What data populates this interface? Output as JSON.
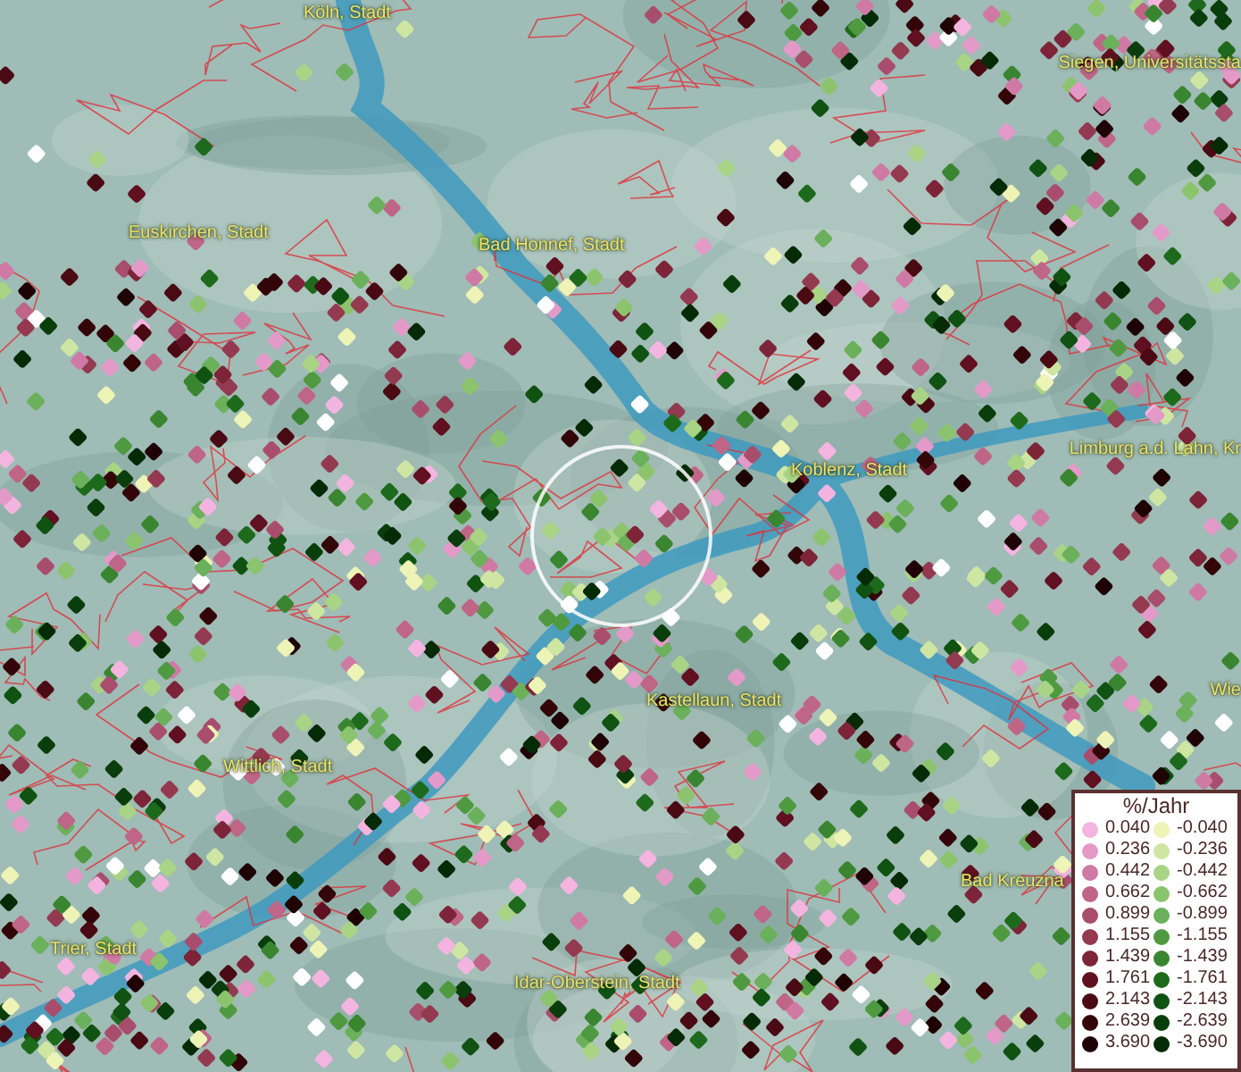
{
  "map": {
    "places": [
      {
        "name": "Köln, Stadt"
      },
      {
        "name": "Siegen, Universitätssta"
      },
      {
        "name": "Euskirchen, Stadt"
      },
      {
        "name": "Bad Honnef, Stadt"
      },
      {
        "name": "Limburg a.d. Lahn, Kr"
      },
      {
        "name": "Koblenz, Stadt"
      },
      {
        "name": "Wie"
      },
      {
        "name": "Kastellaun, Stadt"
      },
      {
        "name": "Wittlich, Stadt"
      },
      {
        "name": "Bad Kreuzna"
      },
      {
        "name": "Trier, Stadt"
      },
      {
        "name": "Idar-Oberstein, Stadt"
      }
    ]
  },
  "legend": {
    "title": "%/Jahr",
    "rows": [
      {
        "positive": {
          "label": "0.040",
          "color": "#f4b4e0"
        },
        "negative": {
          "label": "-0.040",
          "color": "#eef3b6"
        }
      },
      {
        "positive": {
          "label": "0.236",
          "color": "#e39ac8"
        },
        "negative": {
          "label": "-0.236",
          "color": "#cfe6a2"
        }
      },
      {
        "positive": {
          "label": "0.442",
          "color": "#cf7aa4"
        },
        "negative": {
          "label": "-0.442",
          "color": "#a9d486"
        }
      },
      {
        "positive": {
          "label": "0.662",
          "color": "#bf6586"
        },
        "negative": {
          "label": "-0.662",
          "color": "#8cc46e"
        }
      },
      {
        "positive": {
          "label": "0.899",
          "color": "#a84e6c"
        },
        "negative": {
          "label": "-0.899",
          "color": "#6bb05a"
        }
      },
      {
        "positive": {
          "label": "1.155",
          "color": "#943a50"
        },
        "negative": {
          "label": "-1.155",
          "color": "#4f9a40"
        }
      },
      {
        "positive": {
          "label": "1.439",
          "color": "#7d2438"
        },
        "negative": {
          "label": "-1.439",
          "color": "#3a8530"
        }
      },
      {
        "positive": {
          "label": "1.761",
          "color": "#601020"
        },
        "negative": {
          "label": "-1.761",
          "color": "#1e6a1c"
        }
      },
      {
        "positive": {
          "label": "2.143",
          "color": "#4a0a14"
        },
        "negative": {
          "label": "-2.143",
          "color": "#0f5212"
        }
      },
      {
        "positive": {
          "label": "2.639",
          "color": "#330508"
        },
        "negative": {
          "label": "-2.639",
          "color": "#0a3d0c"
        }
      },
      {
        "positive": {
          "label": "3.690",
          "color": "#1e0204"
        },
        "negative": {
          "label": "-3.690",
          "color": "#052a06"
        }
      }
    ]
  }
}
